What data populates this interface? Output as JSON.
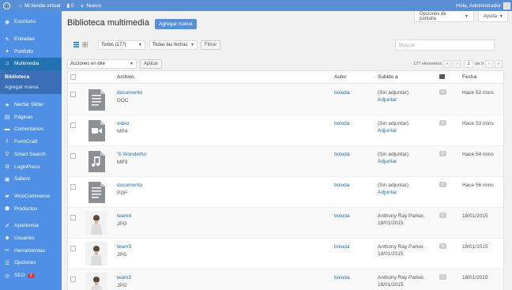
{
  "adminbar": {
    "site_name": "Mi tienda virtual",
    "comments_count": "0",
    "new_label": "Nuevo",
    "greeting": "Hola, Administrador"
  },
  "screen_options": "Opciones de pantalla",
  "help": "Ayuda",
  "sidebar": {
    "items": [
      {
        "label": "Escritorio",
        "icon": "dashboard-icon"
      },
      {
        "label": "Entradas",
        "icon": "pin-icon"
      },
      {
        "label": "Portfolio",
        "icon": "portfolio-icon"
      },
      {
        "label": "Multimedia",
        "icon": "media-icon"
      },
      {
        "label": "Nectar Slider",
        "icon": "star-icon"
      },
      {
        "label": "Páginas",
        "icon": "pages-icon"
      },
      {
        "label": "Comentarios",
        "icon": "comment-icon"
      },
      {
        "label": "FormCraft",
        "icon": "formcraft-icon"
      },
      {
        "label": "Smart Search",
        "icon": "search-icon"
      },
      {
        "label": "LoginPress",
        "icon": "gear-icon"
      },
      {
        "label": "Salient",
        "icon": "salient-icon"
      },
      {
        "label": "WooCommerce",
        "icon": "woo-icon"
      },
      {
        "label": "Productos",
        "icon": "box-icon"
      },
      {
        "label": "Apariencia",
        "icon": "brush-icon"
      },
      {
        "label": "Usuarios",
        "icon": "users-icon"
      },
      {
        "label": "Herramientas",
        "icon": "wrench-icon"
      },
      {
        "label": "Opciones",
        "icon": "settings-icon"
      },
      {
        "label": "SEO",
        "icon": "seo-icon",
        "badge": "2"
      }
    ],
    "submenu": [
      "Biblioteca",
      "Agregar nueva"
    ]
  },
  "page": {
    "title": "Biblioteca multimedia",
    "add_new": "Agregar nueva"
  },
  "filters": {
    "type_select": "Todos (177)",
    "date_select": "Todas las fechas",
    "filter_button": "Filtrar",
    "search_placeholder": "Buscar",
    "bulk_select": "Acciones en lote",
    "apply_button": "Aplicar"
  },
  "pagination": {
    "count": "177 elementos",
    "current": "1",
    "of": "de 9",
    "first": "«",
    "prev": "‹",
    "next": "›",
    "last": "»"
  },
  "table": {
    "headers": {
      "file": "Archivo",
      "author": "Autor",
      "uploaded_to": "Subido a",
      "date": "Fecha"
    },
    "rows": [
      {
        "title": "documento",
        "ext": "DOC",
        "author": "boluda",
        "up1": "(Sin adjuntar)",
        "up2": "Adjuntar",
        "comments": "0",
        "date": "Hace 52 mins",
        "thumb": "document"
      },
      {
        "title": "video",
        "ext": "MP4",
        "author": "boluda",
        "up1": "(Sin adjuntar)",
        "up2": "Adjuntar",
        "comments": "0",
        "date": "Hace 53 mins",
        "thumb": "video"
      },
      {
        "title": "'S Wonderful",
        "ext": "MP3",
        "author": "boluda",
        "up1": "(Sin adjuntar)",
        "up2": "Adjuntar",
        "comments": "0",
        "date": "Hace 54 mins",
        "thumb": "audio"
      },
      {
        "title": "documento",
        "ext": "PDF",
        "author": "boluda",
        "up1": "(Sin adjuntar)",
        "up2": "Adjuntar",
        "comments": "0",
        "date": "Hace 56 mins",
        "thumb": "document"
      },
      {
        "title": "team4",
        "ext": "JPG",
        "author": "boluda",
        "up1": "Anthony Ray Parker,",
        "up2": "18/01/2015",
        "comments": "0",
        "date": "18/01/2015",
        "thumb": "photo"
      },
      {
        "title": "team3",
        "ext": "JPG",
        "author": "boluda",
        "up1": "Anthony Ray Parker,",
        "up2": "18/01/2015",
        "comments": "0",
        "date": "18/01/2015",
        "thumb": "photo"
      },
      {
        "title": "team2",
        "ext": "JPG",
        "author": "boluda",
        "up1": "Anthony Ray Parker,",
        "up2": "18/01/2015",
        "comments": "0",
        "date": "18/01/2015",
        "thumb": "photo"
      }
    ]
  }
}
